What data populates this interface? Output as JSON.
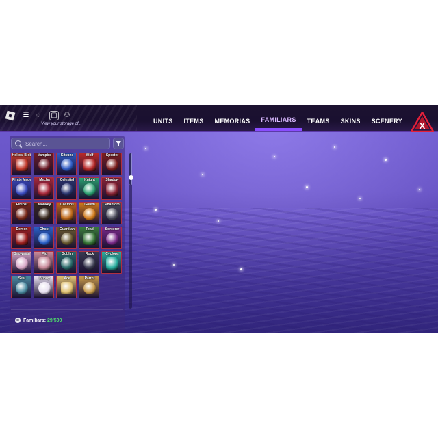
{
  "toolbar": {
    "menu_glyph": "☰",
    "chat_glyph": "◌",
    "bag_glyph": "▢",
    "people_glyph": "⚇",
    "view_storage_text": "View your storage of..."
  },
  "tabs": [
    {
      "label": "UNITS"
    },
    {
      "label": "ITEMS"
    },
    {
      "label": "MEMORIAS"
    },
    {
      "label": "FAMILIARS",
      "active": true
    },
    {
      "label": "TEAMS"
    },
    {
      "label": "SKINS"
    },
    {
      "label": "SCENERY"
    }
  ],
  "search": {
    "placeholder": "Search..."
  },
  "familiars": {
    "items": [
      {
        "name": "Hollow Blob",
        "color": "#c23a2c"
      },
      {
        "name": "Vampire",
        "color": "#6d1d28"
      },
      {
        "name": "Kitsune",
        "color": "#2f5bc4"
      },
      {
        "name": "Wolf",
        "color": "#b92a2a"
      },
      {
        "name": "Specter",
        "color": "#7d1f1f"
      },
      {
        "name": "Pirate Mage",
        "color": "#3a4ac0"
      },
      {
        "name": "Mecha",
        "color": "#a8283a"
      },
      {
        "name": "Celestial",
        "color": "#2a3570"
      },
      {
        "name": "Knight",
        "color": "#2aa070"
      },
      {
        "name": "Shadow",
        "color": "#8a2436"
      },
      {
        "name": "Firebat",
        "color": "#7a2a1a"
      },
      {
        "name": "Monkey",
        "color": "#3a2a20"
      },
      {
        "name": "Cosmos",
        "color": "#c06a1a"
      },
      {
        "name": "Golem",
        "color": "#d07a1a"
      },
      {
        "name": "Phantom",
        "color": "#4a4a5a"
      },
      {
        "name": "Demon",
        "color": "#a02020"
      },
      {
        "name": "Ghost",
        "color": "#2a60c8"
      },
      {
        "name": "Guardian",
        "color": "#6a5a30"
      },
      {
        "name": "Toad",
        "color": "#3a7a3a"
      },
      {
        "name": "Sorcerer",
        "color": "#7a2a8a"
      },
      {
        "name": "Snowman",
        "color": "#d8a8c8"
      },
      {
        "name": "Pig",
        "color": "#c88a9a"
      },
      {
        "name": "Goblin",
        "color": "#2a6a6a"
      },
      {
        "name": "Rock",
        "color": "#3a3a50"
      },
      {
        "name": "Cyclops",
        "color": "#2ab0a0"
      },
      {
        "name": "Seal",
        "color": "#4a8aa0"
      },
      {
        "name": "Bunny",
        "color": "#e8e0f0"
      },
      {
        "name": "Ace",
        "color": "#e0c070"
      },
      {
        "name": "Parrot",
        "color": "#c89a4a"
      }
    ],
    "count_label": "Familiars: ",
    "count_value": "29/500"
  }
}
